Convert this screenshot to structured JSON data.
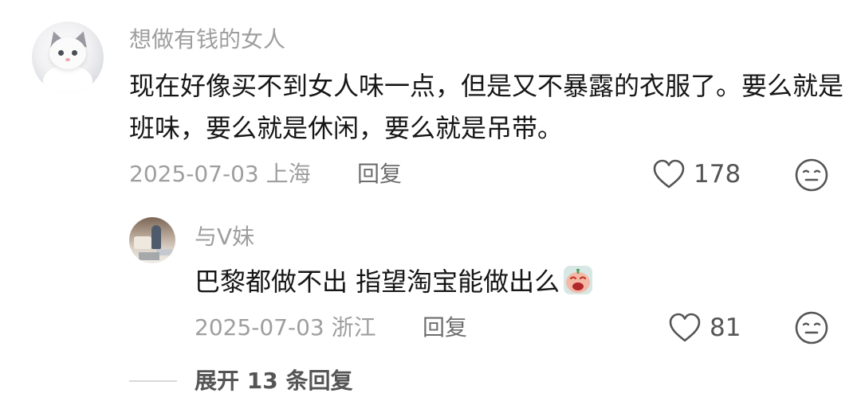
{
  "comment": {
    "username": "想做有钱的女人",
    "text": "现在好像买不到女人味一点，但是又不暴露的衣服了。要么就是班味，要么就是休闲，要么就是吊带。",
    "date_location": "2025-07-03 上海",
    "reply_label": "回复",
    "like_count": "178",
    "like_icon": "heart-outline",
    "dislike_icon": "neutral-face-outline"
  },
  "reply": {
    "username": "与V妹",
    "text": "巴黎都做不出 指望淘宝能做出么",
    "sticker_icon": "crying-emoji-sticker",
    "date_location": "2025-07-03 浙江",
    "reply_label": "回复",
    "like_count": "81",
    "like_icon": "heart-outline",
    "dislike_icon": "neutral-face-outline"
  },
  "expand": {
    "label": "展开 13 条回复"
  },
  "colors": {
    "username": "#9e9e9e",
    "text": "#161616",
    "meta": "#9e9e9e",
    "icon": "#555555"
  }
}
